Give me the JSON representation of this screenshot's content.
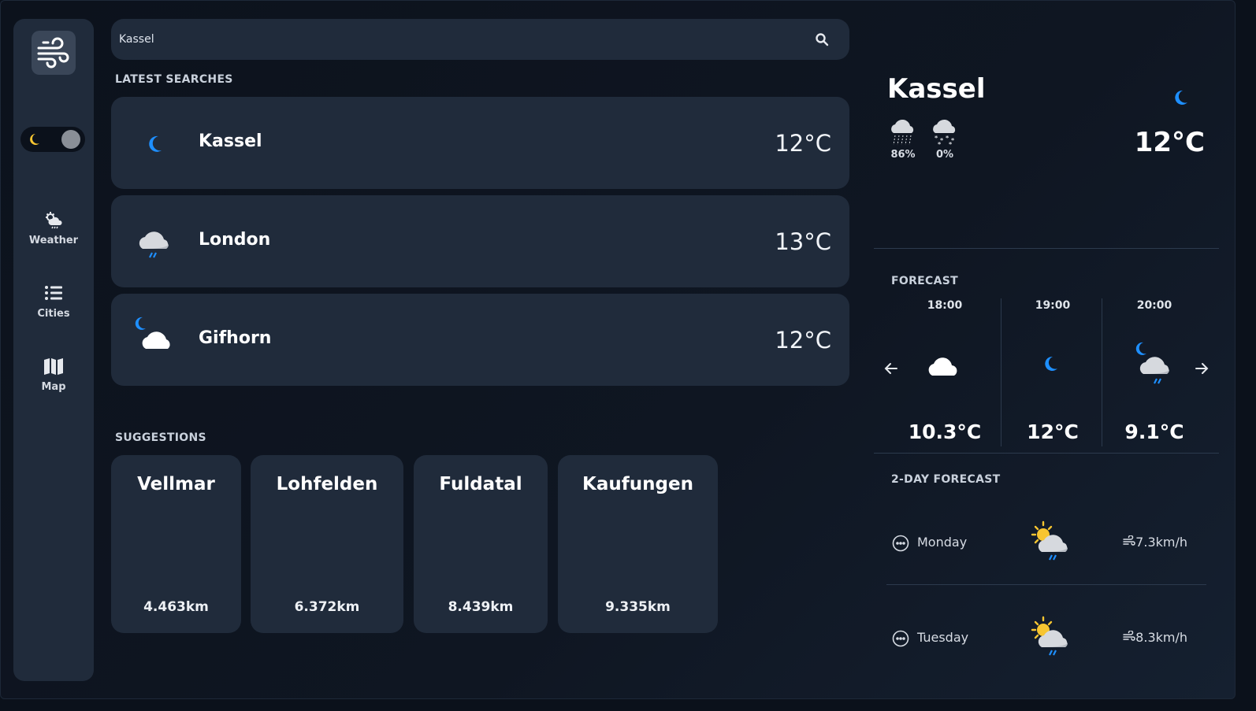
{
  "sidebar": {
    "logo_icon": "wind-icon",
    "theme_toggle": {
      "mode": "dark"
    },
    "items": [
      {
        "label": "Weather",
        "icon": "weather-cloud-sun-icon"
      },
      {
        "label": "Cities",
        "icon": "list-icon"
      },
      {
        "label": "Map",
        "icon": "map-icon"
      }
    ]
  },
  "search": {
    "value": "Kassel",
    "icon": "search-icon"
  },
  "latest_searches": {
    "heading": "LATEST SEARCHES",
    "items": [
      {
        "city": "Kassel",
        "temp": "12°C",
        "icon": "moon-icon"
      },
      {
        "city": "London",
        "temp": "13°C",
        "icon": "cloud-rain-icon"
      },
      {
        "city": "Gifhorn",
        "temp": "12°C",
        "icon": "moon-cloud-icon"
      }
    ]
  },
  "suggestions": {
    "heading": "SUGGESTIONS",
    "items": [
      {
        "city": "Vellmar",
        "distance": "4.463km"
      },
      {
        "city": "Lohfelden",
        "distance": "6.372km"
      },
      {
        "city": "Fuldatal",
        "distance": "8.439km"
      },
      {
        "city": "Kaufungen",
        "distance": "9.335km"
      }
    ]
  },
  "current": {
    "city": "Kassel",
    "temp": "12°C",
    "icon": "moon-icon",
    "rain_chance": "86%",
    "snow_chance": "0%"
  },
  "forecast": {
    "heading": "FORECAST",
    "items": [
      {
        "time": "18:00",
        "temp": "10.3°C",
        "icon": "cloud-icon"
      },
      {
        "time": "19:00",
        "temp": "12°C",
        "icon": "moon-icon"
      },
      {
        "time": "20:00",
        "temp": "9.1°C",
        "icon": "moon-cloud-rain-icon"
      }
    ]
  },
  "two_day": {
    "heading": "2-DAY FORECAST",
    "items": [
      {
        "day": "Monday",
        "wind": "7.3km/h",
        "icon": "sun-cloud-rain-icon"
      },
      {
        "day": "Tuesday",
        "wind": "8.3km/h",
        "icon": "sun-cloud-rain-icon"
      }
    ]
  },
  "colors": {
    "background": "#0b111b",
    "card": "#202b3b",
    "moon": "#1e8fff",
    "sun": "#f7c531"
  }
}
